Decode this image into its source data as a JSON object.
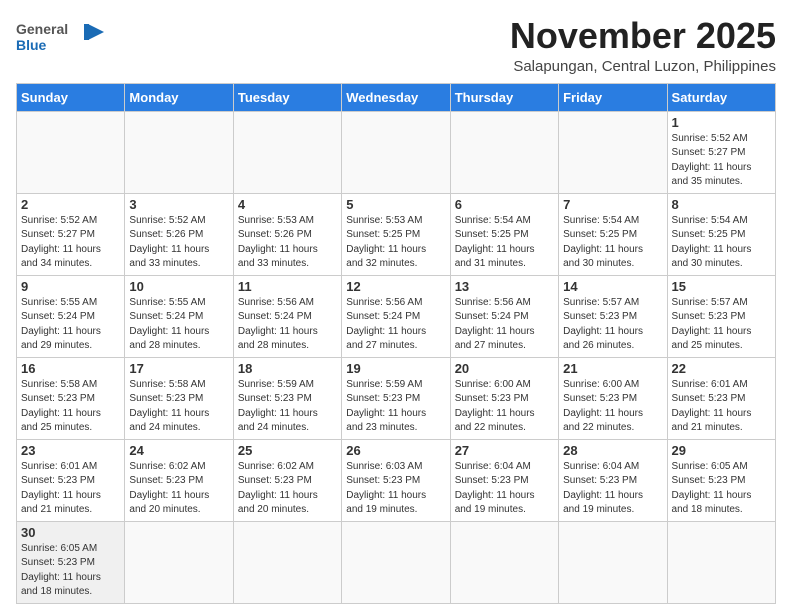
{
  "header": {
    "logo_general": "General",
    "logo_blue": "Blue",
    "month_title": "November 2025",
    "location": "Salapungan, Central Luzon, Philippines"
  },
  "weekdays": [
    "Sunday",
    "Monday",
    "Tuesday",
    "Wednesday",
    "Thursday",
    "Friday",
    "Saturday"
  ],
  "weeks": [
    [
      {
        "day": "",
        "info": ""
      },
      {
        "day": "",
        "info": ""
      },
      {
        "day": "",
        "info": ""
      },
      {
        "day": "",
        "info": ""
      },
      {
        "day": "",
        "info": ""
      },
      {
        "day": "",
        "info": ""
      },
      {
        "day": "1",
        "info": "Sunrise: 5:52 AM\nSunset: 5:27 PM\nDaylight: 11 hours\nand 35 minutes."
      }
    ],
    [
      {
        "day": "2",
        "info": "Sunrise: 5:52 AM\nSunset: 5:27 PM\nDaylight: 11 hours\nand 34 minutes."
      },
      {
        "day": "3",
        "info": "Sunrise: 5:52 AM\nSunset: 5:26 PM\nDaylight: 11 hours\nand 33 minutes."
      },
      {
        "day": "4",
        "info": "Sunrise: 5:53 AM\nSunset: 5:26 PM\nDaylight: 11 hours\nand 33 minutes."
      },
      {
        "day": "5",
        "info": "Sunrise: 5:53 AM\nSunset: 5:25 PM\nDaylight: 11 hours\nand 32 minutes."
      },
      {
        "day": "6",
        "info": "Sunrise: 5:54 AM\nSunset: 5:25 PM\nDaylight: 11 hours\nand 31 minutes."
      },
      {
        "day": "7",
        "info": "Sunrise: 5:54 AM\nSunset: 5:25 PM\nDaylight: 11 hours\nand 30 minutes."
      },
      {
        "day": "8",
        "info": "Sunrise: 5:54 AM\nSunset: 5:25 PM\nDaylight: 11 hours\nand 30 minutes."
      }
    ],
    [
      {
        "day": "9",
        "info": "Sunrise: 5:55 AM\nSunset: 5:24 PM\nDaylight: 11 hours\nand 29 minutes."
      },
      {
        "day": "10",
        "info": "Sunrise: 5:55 AM\nSunset: 5:24 PM\nDaylight: 11 hours\nand 28 minutes."
      },
      {
        "day": "11",
        "info": "Sunrise: 5:56 AM\nSunset: 5:24 PM\nDaylight: 11 hours\nand 28 minutes."
      },
      {
        "day": "12",
        "info": "Sunrise: 5:56 AM\nSunset: 5:24 PM\nDaylight: 11 hours\nand 27 minutes."
      },
      {
        "day": "13",
        "info": "Sunrise: 5:56 AM\nSunset: 5:24 PM\nDaylight: 11 hours\nand 27 minutes."
      },
      {
        "day": "14",
        "info": "Sunrise: 5:57 AM\nSunset: 5:23 PM\nDaylight: 11 hours\nand 26 minutes."
      },
      {
        "day": "15",
        "info": "Sunrise: 5:57 AM\nSunset: 5:23 PM\nDaylight: 11 hours\nand 25 minutes."
      }
    ],
    [
      {
        "day": "16",
        "info": "Sunrise: 5:58 AM\nSunset: 5:23 PM\nDaylight: 11 hours\nand 25 minutes."
      },
      {
        "day": "17",
        "info": "Sunrise: 5:58 AM\nSunset: 5:23 PM\nDaylight: 11 hours\nand 24 minutes."
      },
      {
        "day": "18",
        "info": "Sunrise: 5:59 AM\nSunset: 5:23 PM\nDaylight: 11 hours\nand 24 minutes."
      },
      {
        "day": "19",
        "info": "Sunrise: 5:59 AM\nSunset: 5:23 PM\nDaylight: 11 hours\nand 23 minutes."
      },
      {
        "day": "20",
        "info": "Sunrise: 6:00 AM\nSunset: 5:23 PM\nDaylight: 11 hours\nand 22 minutes."
      },
      {
        "day": "21",
        "info": "Sunrise: 6:00 AM\nSunset: 5:23 PM\nDaylight: 11 hours\nand 22 minutes."
      },
      {
        "day": "22",
        "info": "Sunrise: 6:01 AM\nSunset: 5:23 PM\nDaylight: 11 hours\nand 21 minutes."
      }
    ],
    [
      {
        "day": "23",
        "info": "Sunrise: 6:01 AM\nSunset: 5:23 PM\nDaylight: 11 hours\nand 21 minutes."
      },
      {
        "day": "24",
        "info": "Sunrise: 6:02 AM\nSunset: 5:23 PM\nDaylight: 11 hours\nand 20 minutes."
      },
      {
        "day": "25",
        "info": "Sunrise: 6:02 AM\nSunset: 5:23 PM\nDaylight: 11 hours\nand 20 minutes."
      },
      {
        "day": "26",
        "info": "Sunrise: 6:03 AM\nSunset: 5:23 PM\nDaylight: 11 hours\nand 19 minutes."
      },
      {
        "day": "27",
        "info": "Sunrise: 6:04 AM\nSunset: 5:23 PM\nDaylight: 11 hours\nand 19 minutes."
      },
      {
        "day": "28",
        "info": "Sunrise: 6:04 AM\nSunset: 5:23 PM\nDaylight: 11 hours\nand 19 minutes."
      },
      {
        "day": "29",
        "info": "Sunrise: 6:05 AM\nSunset: 5:23 PM\nDaylight: 11 hours\nand 18 minutes."
      }
    ],
    [
      {
        "day": "30",
        "info": "Sunrise: 6:05 AM\nSunset: 5:23 PM\nDaylight: 11 hours\nand 18 minutes."
      },
      {
        "day": "",
        "info": ""
      },
      {
        "day": "",
        "info": ""
      },
      {
        "day": "",
        "info": ""
      },
      {
        "day": "",
        "info": ""
      },
      {
        "day": "",
        "info": ""
      },
      {
        "day": "",
        "info": ""
      }
    ]
  ]
}
